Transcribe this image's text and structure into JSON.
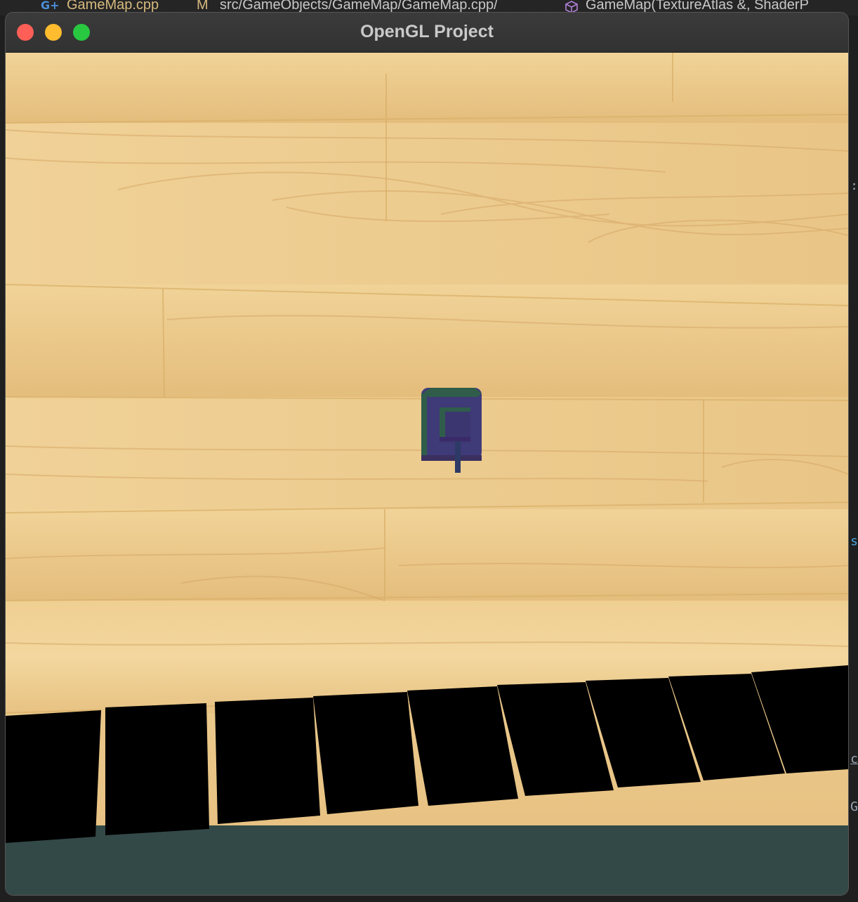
{
  "editor": {
    "file_name": "GameMap.cpp",
    "modified_flag": "M",
    "path": "src/GameObjects/GameMap/GameMap.cpp/",
    "symbol": "GameMap(TextureAtlas &, ShaderP",
    "right_edge_glyphs": [
      ":",
      "s",
      "c",
      "G"
    ]
  },
  "window": {
    "title": "OpenGL Project",
    "controls": [
      "close",
      "minimize",
      "zoom"
    ]
  },
  "scene": {
    "floor_texture": "wood-planks",
    "player_object": "tank",
    "tank_colors": {
      "body": "#3f3a78",
      "top_edge": "#2f5d4a",
      "barrel": "#2e3a66"
    },
    "wall_color": "#000000",
    "clear_color": "#334948"
  }
}
